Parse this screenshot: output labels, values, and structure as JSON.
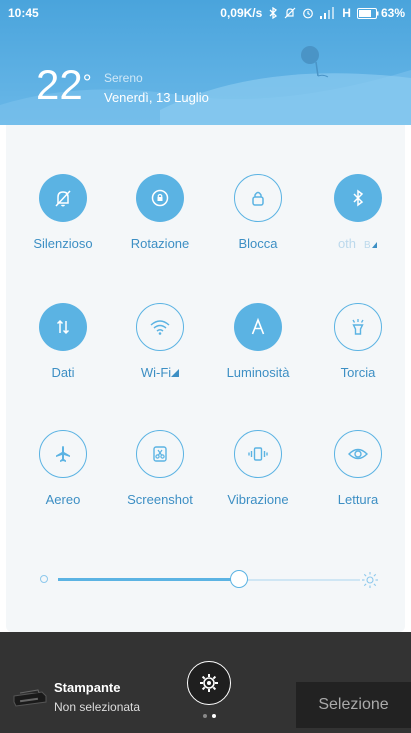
{
  "status_bar": {
    "time": "10:45",
    "network_speed": "0,09K/s",
    "network_type": "H",
    "battery": "63%",
    "icons": [
      "bluetooth-icon",
      "mute-icon",
      "alarm-icon",
      "signal-icon",
      "battery-icon"
    ]
  },
  "weather": {
    "temperature": "22",
    "degree": "°",
    "condition": "Sereno",
    "date": "Venerdì, 13 Luglio"
  },
  "toggles": [
    {
      "label": "Silenzioso",
      "icon": "mute-bell-icon",
      "active": true
    },
    {
      "label": "Rotazione",
      "icon": "rotation-lock-icon",
      "active": true
    },
    {
      "label": "Blocca",
      "icon": "lock-icon",
      "active": false
    },
    {
      "label": "oth",
      "icon": "bluetooth-icon",
      "active": true
    },
    {
      "label": "Dati",
      "icon": "data-icon",
      "active": true
    },
    {
      "label": "Wi-Fi",
      "icon": "wifi-icon",
      "active": false
    },
    {
      "label": "Luminosità",
      "icon": "auto-brightness-icon",
      "active": true
    },
    {
      "label": "Torcia",
      "icon": "flashlight-icon",
      "active": false
    },
    {
      "label": "Aereo",
      "icon": "airplane-icon",
      "active": false
    },
    {
      "label": "Screenshot",
      "icon": "screenshot-icon",
      "active": false
    },
    {
      "label": "Vibrazione",
      "icon": "vibration-icon",
      "active": false
    },
    {
      "label": "Lettura",
      "icon": "eye-icon",
      "active": false
    }
  ],
  "brightness": {
    "level_fraction": 0.6
  },
  "bottom": {
    "printer_title": "Stampante",
    "printer_subtitle": "Non selezionata",
    "select_label": "Selezione",
    "page_indicator": {
      "pages": 2,
      "current": 2
    }
  }
}
